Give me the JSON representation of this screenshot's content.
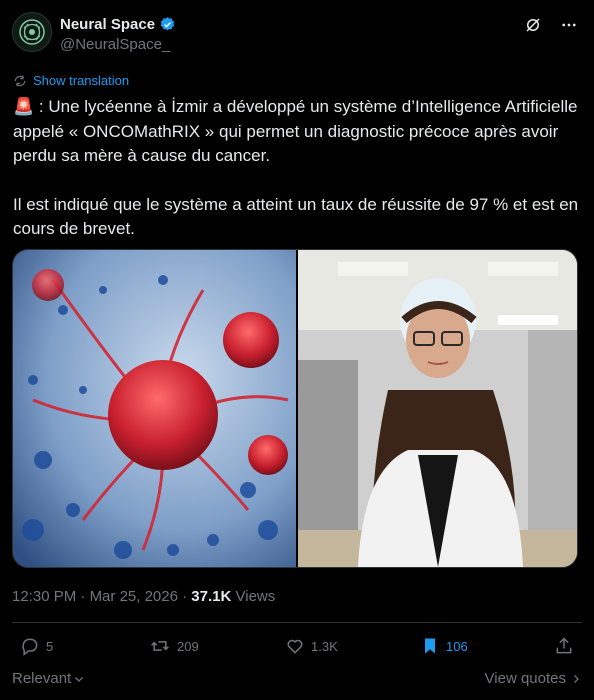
{
  "author": {
    "display_name": "Neural Space",
    "handle": "@NeuralSpace_",
    "verified_icon": "verified-badge-icon"
  },
  "header_icons": [
    "grok-icon",
    "more-icon"
  ],
  "translation": {
    "label": "Show translation",
    "icon": "translate-icon"
  },
  "tweet": {
    "emoji": "🚨",
    "paragraph1": " : Une lycéenne à İzmir a développé un système d’Intelligence Artificielle appelé « ONCOMathRIX » qui permet un diagnostic précoce après avoir perdu sa mère à cause du cancer.",
    "paragraph2": "Il est indiqué que le système a atteint un taux de réussite de 97 % et est en cours de brevet."
  },
  "media": {
    "left_image": "cancer-cell-illustration",
    "right_image": "student-portrait-lab"
  },
  "meta": {
    "time": "12:30 PM",
    "separator": "·",
    "date": "Mar 25, 2026",
    "views_count": "37.1K",
    "views_label": "Views"
  },
  "actions": {
    "replies": "5",
    "reposts": "209",
    "likes": "1.3K",
    "bookmarks": "106"
  },
  "footer": {
    "relevant_label": "Relevant",
    "view_quotes_label": "View quotes"
  },
  "colors": {
    "accent": "#1d9bf0",
    "background": "#000000",
    "text": "#e7e9ea",
    "muted": "#71767b"
  }
}
